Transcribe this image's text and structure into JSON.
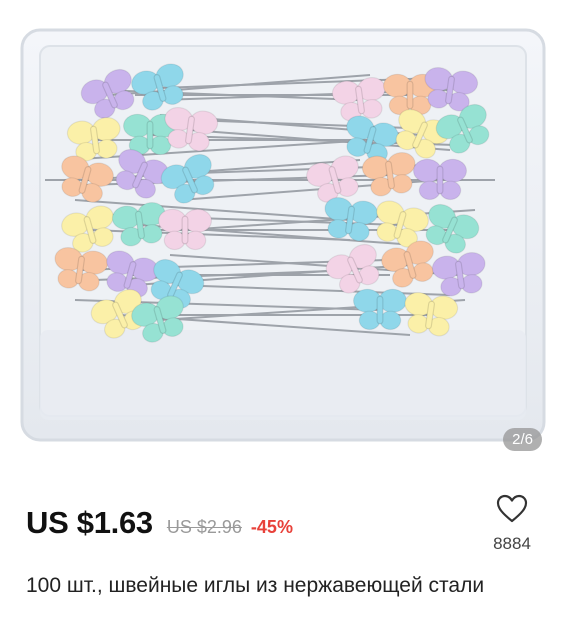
{
  "gallery": {
    "counter": "2/6",
    "image_alt": "Box of butterfly-head sewing pins"
  },
  "price": {
    "current": "US $1.63",
    "original": "US $2.96",
    "discount": "-45%"
  },
  "wishlist": {
    "icon": "heart-icon",
    "count": "8884"
  },
  "product": {
    "title": "100 шт., швейные иглы из нержавеющей стали"
  },
  "colors": {
    "discount": "#e8413a",
    "butterflies": [
      "#c9b3ec",
      "#8fd7ea",
      "#fbf0a8",
      "#96e2d3",
      "#f3d3e6",
      "#f8c4a0"
    ]
  }
}
